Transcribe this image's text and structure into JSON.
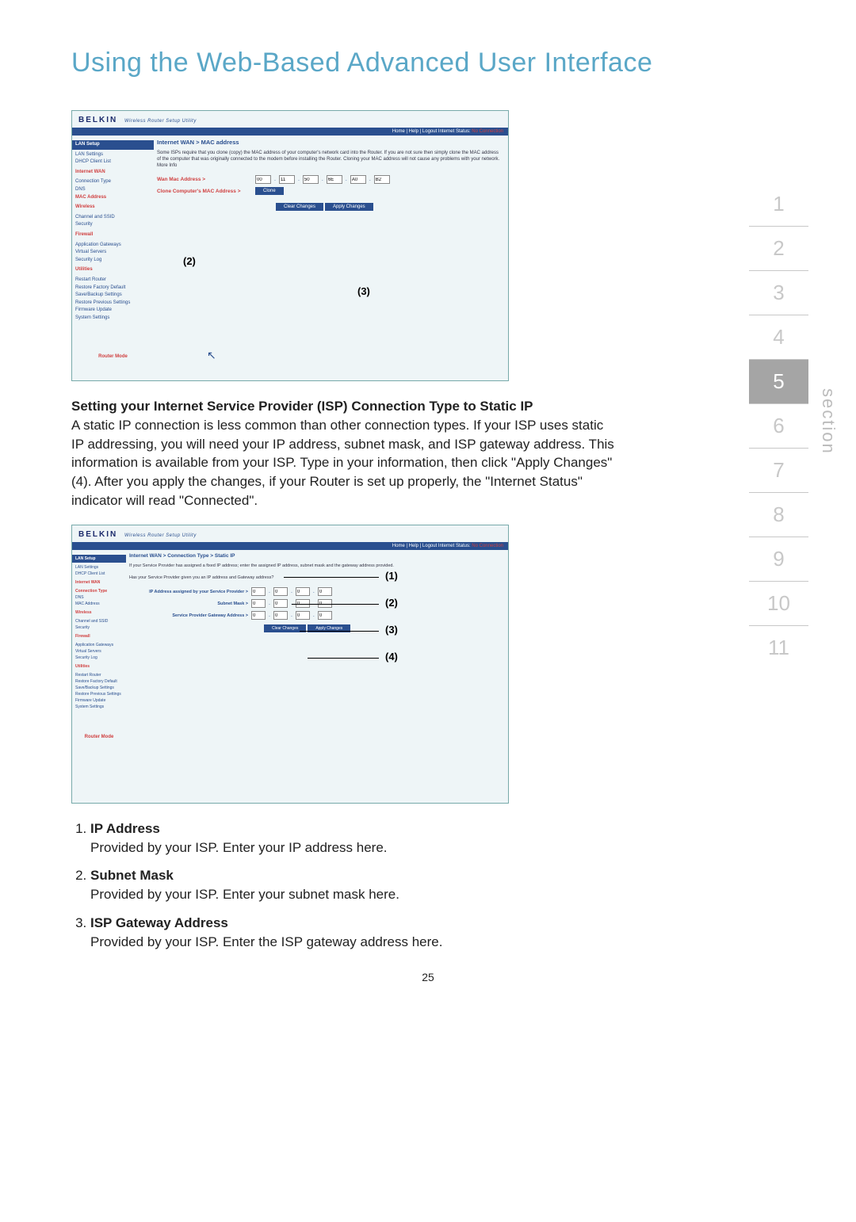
{
  "page_title": "Using the Web-Based Advanced User Interface",
  "side_nav": {
    "items": [
      "1",
      "2",
      "3",
      "4",
      "5",
      "6",
      "7",
      "8",
      "9",
      "10",
      "11"
    ],
    "active_index": 4,
    "label": "section"
  },
  "shot1": {
    "brand": "BELKIN",
    "brand_sub": "Wireless Router Setup Utility",
    "topbar": "Home | Help | Logout   Internet Status:",
    "topbar_status": "No Connection",
    "sidebar": {
      "groups": [
        {
          "header": "LAN Setup",
          "items": [
            "LAN Settings",
            "DHCP Client List"
          ]
        },
        {
          "header": "Internet WAN",
          "items": [
            "Connection Type",
            "DNS",
            "MAC Address"
          ],
          "sel_header": true
        },
        {
          "header": "Wireless",
          "items": [
            "Channel and SSID",
            "Security"
          ]
        },
        {
          "header": "Firewall",
          "items": [
            "Application Gateways",
            "Virtual Servers",
            "Security Log"
          ]
        },
        {
          "header": "Utilities",
          "items": [
            "Restart Router",
            "Restore Factory Default",
            "Save/Backup Settings",
            "Restore Previous Settings",
            "Firmware Update",
            "System Settings"
          ]
        }
      ],
      "footer": "Router Mode"
    },
    "main": {
      "crumb": "Internet WAN > MAC address",
      "desc": "Some ISPs require that you clone (copy) the MAC address of your computer's network card into the Router. If you are not sure then simply clone the MAC address of the computer that was originally connected to the modem before installing the Router. Cloning your MAC address will not cause any problems with your network. More Info",
      "row1_label": "Wan Mac Address >",
      "mac": [
        "00",
        "11",
        "50",
        "6E",
        "A0",
        "B2"
      ],
      "row2_label": "Clone Computer's MAC Address >",
      "clone_btn": "Clone",
      "clear_btn": "Clear Changes",
      "apply_btn": "Apply Changes"
    },
    "callouts": {
      "c2": "(2)",
      "c3": "(3)"
    }
  },
  "para1_heading": "Setting your Internet Service Provider (ISP) Connection Type to Static IP",
  "para1_body": "A static IP connection is less common than other connection types. If your ISP uses static IP addressing, you will need your IP address, subnet mask, and ISP gateway address. This information is available from your ISP. Type in your information, then click \"Apply Changes\" (4). After you apply the changes, if your Router is set up properly, the \"Internet Status\" indicator will read \"Connected\".",
  "shot2": {
    "brand": "BELKIN",
    "brand_sub": "Wireless Router Setup Utility",
    "topbar": "Home | Help | Logout   Internet Status:",
    "topbar_status": "No Connection",
    "sidebar": {
      "groups": [
        {
          "header": "LAN Setup",
          "items": [
            "LAN Settings",
            "DHCP Client List"
          ]
        },
        {
          "header": "Internet WAN",
          "items": [
            "Connection Type",
            "DNS",
            "MAC Address"
          ],
          "sel_header": true
        },
        {
          "header": "Wireless",
          "items": [
            "Channel and SSID",
            "Security"
          ]
        },
        {
          "header": "Firewall",
          "items": [
            "Application Gateways",
            "Virtual Servers",
            "Security Log"
          ]
        },
        {
          "header": "Utilities",
          "items": [
            "Restart Router",
            "Restore Factory Default",
            "Save/Backup Settings",
            "Restore Previous Settings",
            "Firmware Update",
            "System Settings"
          ]
        }
      ],
      "footer": "Router Mode"
    },
    "main": {
      "crumb": "Internet WAN > Connection Type > Static IP",
      "desc1": "If your Service Provider has assigned a fixed IP address; enter the assigned IP address, subnet mask and the gateway address provided.",
      "desc2": "Has your Service Provider given you an IP address and Gateway address?",
      "row1_label": "IP Address assigned by your Service Provider >",
      "row2_label": "Subnet Mask >",
      "row3_label": "Service Provider Gateway Address >",
      "ip_default": "0",
      "clear_btn": "Clear Changes",
      "apply_btn": "Apply Changes"
    },
    "callouts": {
      "c1": "(1)",
      "c2": "(2)",
      "c3": "(3)",
      "c4": "(4)"
    }
  },
  "defs": [
    {
      "t": "IP Address",
      "d": "Provided by your ISP. Enter your IP address here."
    },
    {
      "t": "Subnet Mask",
      "d": "Provided by your ISP. Enter your subnet mask here."
    },
    {
      "t": "ISP Gateway Address",
      "d": "Provided by your ISP. Enter the ISP gateway address here."
    }
  ],
  "page_num": "25"
}
